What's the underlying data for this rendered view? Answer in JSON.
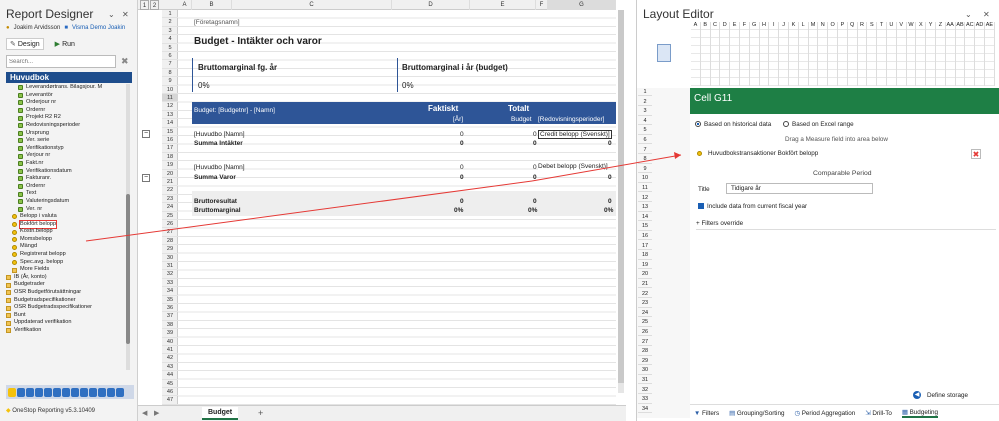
{
  "left_panel": {
    "title": "Report Designer",
    "win_icons": [
      "⌄",
      "✕"
    ],
    "user": "Joakim Arvidsson",
    "company": "Visma Demo Joakin",
    "tabs": [
      "Design",
      "Run"
    ],
    "search_placeholder": "Search...",
    "section_header": "Huvudbok",
    "tree": [
      {
        "label": "Leverandørtrans. Bilagsjour. M",
        "icon": "doc",
        "indent": 2
      },
      {
        "label": "Leverantör",
        "icon": "doc",
        "indent": 2
      },
      {
        "label": "Orderjour nr",
        "icon": "doc",
        "indent": 2
      },
      {
        "label": "Ordernr",
        "icon": "doc",
        "indent": 2
      },
      {
        "label": "Projekt R2 R2",
        "icon": "doc",
        "indent": 2
      },
      {
        "label": "Redovisningsperioder",
        "icon": "doc",
        "indent": 2
      },
      {
        "label": "Ursprung",
        "icon": "doc",
        "indent": 2
      },
      {
        "label": "Ver. serie",
        "icon": "doc",
        "indent": 2
      },
      {
        "label": "Verifikationstyp",
        "icon": "doc",
        "indent": 2
      },
      {
        "label": "Verjour nr",
        "icon": "doc",
        "indent": 2
      },
      {
        "label": "Fakt.nr",
        "icon": "doc",
        "indent": 2
      },
      {
        "label": "Verifikationsdatum",
        "icon": "doc",
        "indent": 2
      },
      {
        "label": "Fakturanr.",
        "icon": "doc",
        "indent": 2
      },
      {
        "label": "Ordernr",
        "icon": "doc",
        "indent": 2
      },
      {
        "label": "Text",
        "icon": "doc",
        "indent": 2
      },
      {
        "label": "Valuteringsdatum",
        "icon": "doc",
        "indent": 2
      },
      {
        "label": "Ver. nr",
        "icon": "doc",
        "indent": 2
      },
      {
        "label": "Belopp i valuta",
        "icon": "coin",
        "indent": 1
      },
      {
        "label": "Bokfört belopp",
        "icon": "coin",
        "indent": 1,
        "highlight": true
      },
      {
        "label": "Kostn.belopp",
        "icon": "coin",
        "indent": 1
      },
      {
        "label": "Momsbelopp",
        "icon": "coin",
        "indent": 1
      },
      {
        "label": "Mängd",
        "icon": "coin",
        "indent": 1
      },
      {
        "label": "Registrerat belopp",
        "icon": "coin",
        "indent": 1
      },
      {
        "label": "Spec.avg. belopp",
        "icon": "coin",
        "indent": 1
      },
      {
        "label": "More Fields",
        "icon": "fold",
        "indent": 1
      },
      {
        "label": "IB (År, konto)",
        "icon": "fold",
        "indent": 0
      },
      {
        "label": "Budgetrader",
        "icon": "fold",
        "indent": 0
      },
      {
        "label": "OSR Budgetförutsättningar",
        "icon": "fold",
        "indent": 0
      },
      {
        "label": "Budgetradspecifikationer",
        "icon": "fold",
        "indent": 0
      },
      {
        "label": "OSR Budgetradsspecifikationer",
        "icon": "fold",
        "indent": 0
      },
      {
        "label": "Bunt",
        "icon": "fold",
        "indent": 0
      },
      {
        "label": "Uppdaterad verifikation",
        "icon": "fold",
        "indent": 0
      },
      {
        "label": "Verifikation",
        "icon": "fold",
        "indent": 0
      }
    ],
    "footer": "OneStop Reporting v5.3.10409"
  },
  "sheet": {
    "col_headers": [
      "A",
      "B",
      "C",
      "D",
      "E",
      "F",
      "G"
    ],
    "level_buttons": [
      "1",
      "2"
    ],
    "rows": [
      "1",
      "2",
      "3",
      "4",
      "5",
      "6",
      "7",
      "8",
      "9",
      "10",
      "11",
      "12",
      "13",
      "14",
      "15",
      "16",
      "17",
      "18",
      "19",
      "20",
      "21",
      "22",
      "23",
      "24",
      "25",
      "26",
      "27",
      "28",
      "29",
      "30",
      "31",
      "32",
      "33",
      "34",
      "35",
      "36",
      "37",
      "38",
      "39",
      "40",
      "41",
      "42",
      "43",
      "44",
      "45",
      "46",
      "47"
    ],
    "company_placeholder": "[Företagsnamn]",
    "report_title": "Budget - Intäkter och varor",
    "kpi1_label": "Bruttomarginal fg. år",
    "kpi1_value": "0%",
    "kpi2_label": "Bruttomarginal i år (budget)",
    "kpi2_value": "0%",
    "band_label": "Budget: [Budgetnr] - [Namn]",
    "band_faktiskt": "Faktiskt",
    "band_ar": "[År]",
    "band_totalt": "Totalt",
    "band_budget": "Budget",
    "band_redov": "[Redovisningsperioder]",
    "r11_label": "[Huvudbo [Namn]",
    "r11_d": "0",
    "r11_e": "0",
    "r11_g": "Credit belopp (Svenskt)]",
    "r12_label": "Summa Intäkter",
    "r12_d": "0",
    "r12_e": "0",
    "r12_g": "0",
    "r14_label": "[Huvudbo [Namn]",
    "r14_d": "0",
    "r14_e": "0",
    "r14_g": "Debet belopp (Svenskt)]",
    "r15_label": "Summa Varor",
    "r15_d": "0",
    "r15_e": "0",
    "r15_g": "0",
    "r17_label": "Bruttoresultat",
    "r17_d": "0",
    "r17_e": "0",
    "r17_g": "0",
    "r18_label": "Bruttomarginal",
    "r18_d": "0%",
    "r18_e": "0%",
    "r18_g": "0%",
    "sheet_tab": "Budget",
    "add_tab": "+"
  },
  "layout_editor": {
    "title": "Layout Editor",
    "win_icons": [
      "⌄",
      "✕"
    ],
    "mini_cols": [
      "A",
      "B",
      "C",
      "D",
      "E",
      "F",
      "G",
      "H",
      "I",
      "J",
      "K",
      "L",
      "M",
      "N",
      "O",
      "P",
      "Q",
      "R",
      "S",
      "T",
      "U",
      "V",
      "W",
      "X",
      "Y",
      "Z",
      "AA",
      "AB",
      "AC",
      "AD",
      "AE"
    ],
    "mini_rows": [
      "1",
      "2",
      "3",
      "4",
      "5",
      "6",
      "7",
      "8",
      "9",
      "10",
      "11",
      "12",
      "13",
      "14",
      "15",
      "16",
      "17",
      "18",
      "19",
      "20",
      "21",
      "22",
      "23",
      "24",
      "25",
      "26",
      "27",
      "28",
      "29",
      "30",
      "31",
      "32",
      "33",
      "34"
    ],
    "cell_title": "Cell G11",
    "radio1": "Based on historical data",
    "radio2": "Based on Excel range",
    "drag_hint": "Drag a Measure field into area below",
    "measure": "Huvudbokstransaktioner Bokfört belopp",
    "comparable": "Comparable Period",
    "title_label": "Title",
    "title_value": "Tidigare år",
    "include_label": "Include data from current fiscal year",
    "filters_override": "Filters override",
    "define_storage": "Define storage",
    "bottom_tabs": [
      "Filters",
      "Grouping/Sorting",
      "Period Aggregation",
      "Drill-To",
      "Budgeting"
    ]
  }
}
